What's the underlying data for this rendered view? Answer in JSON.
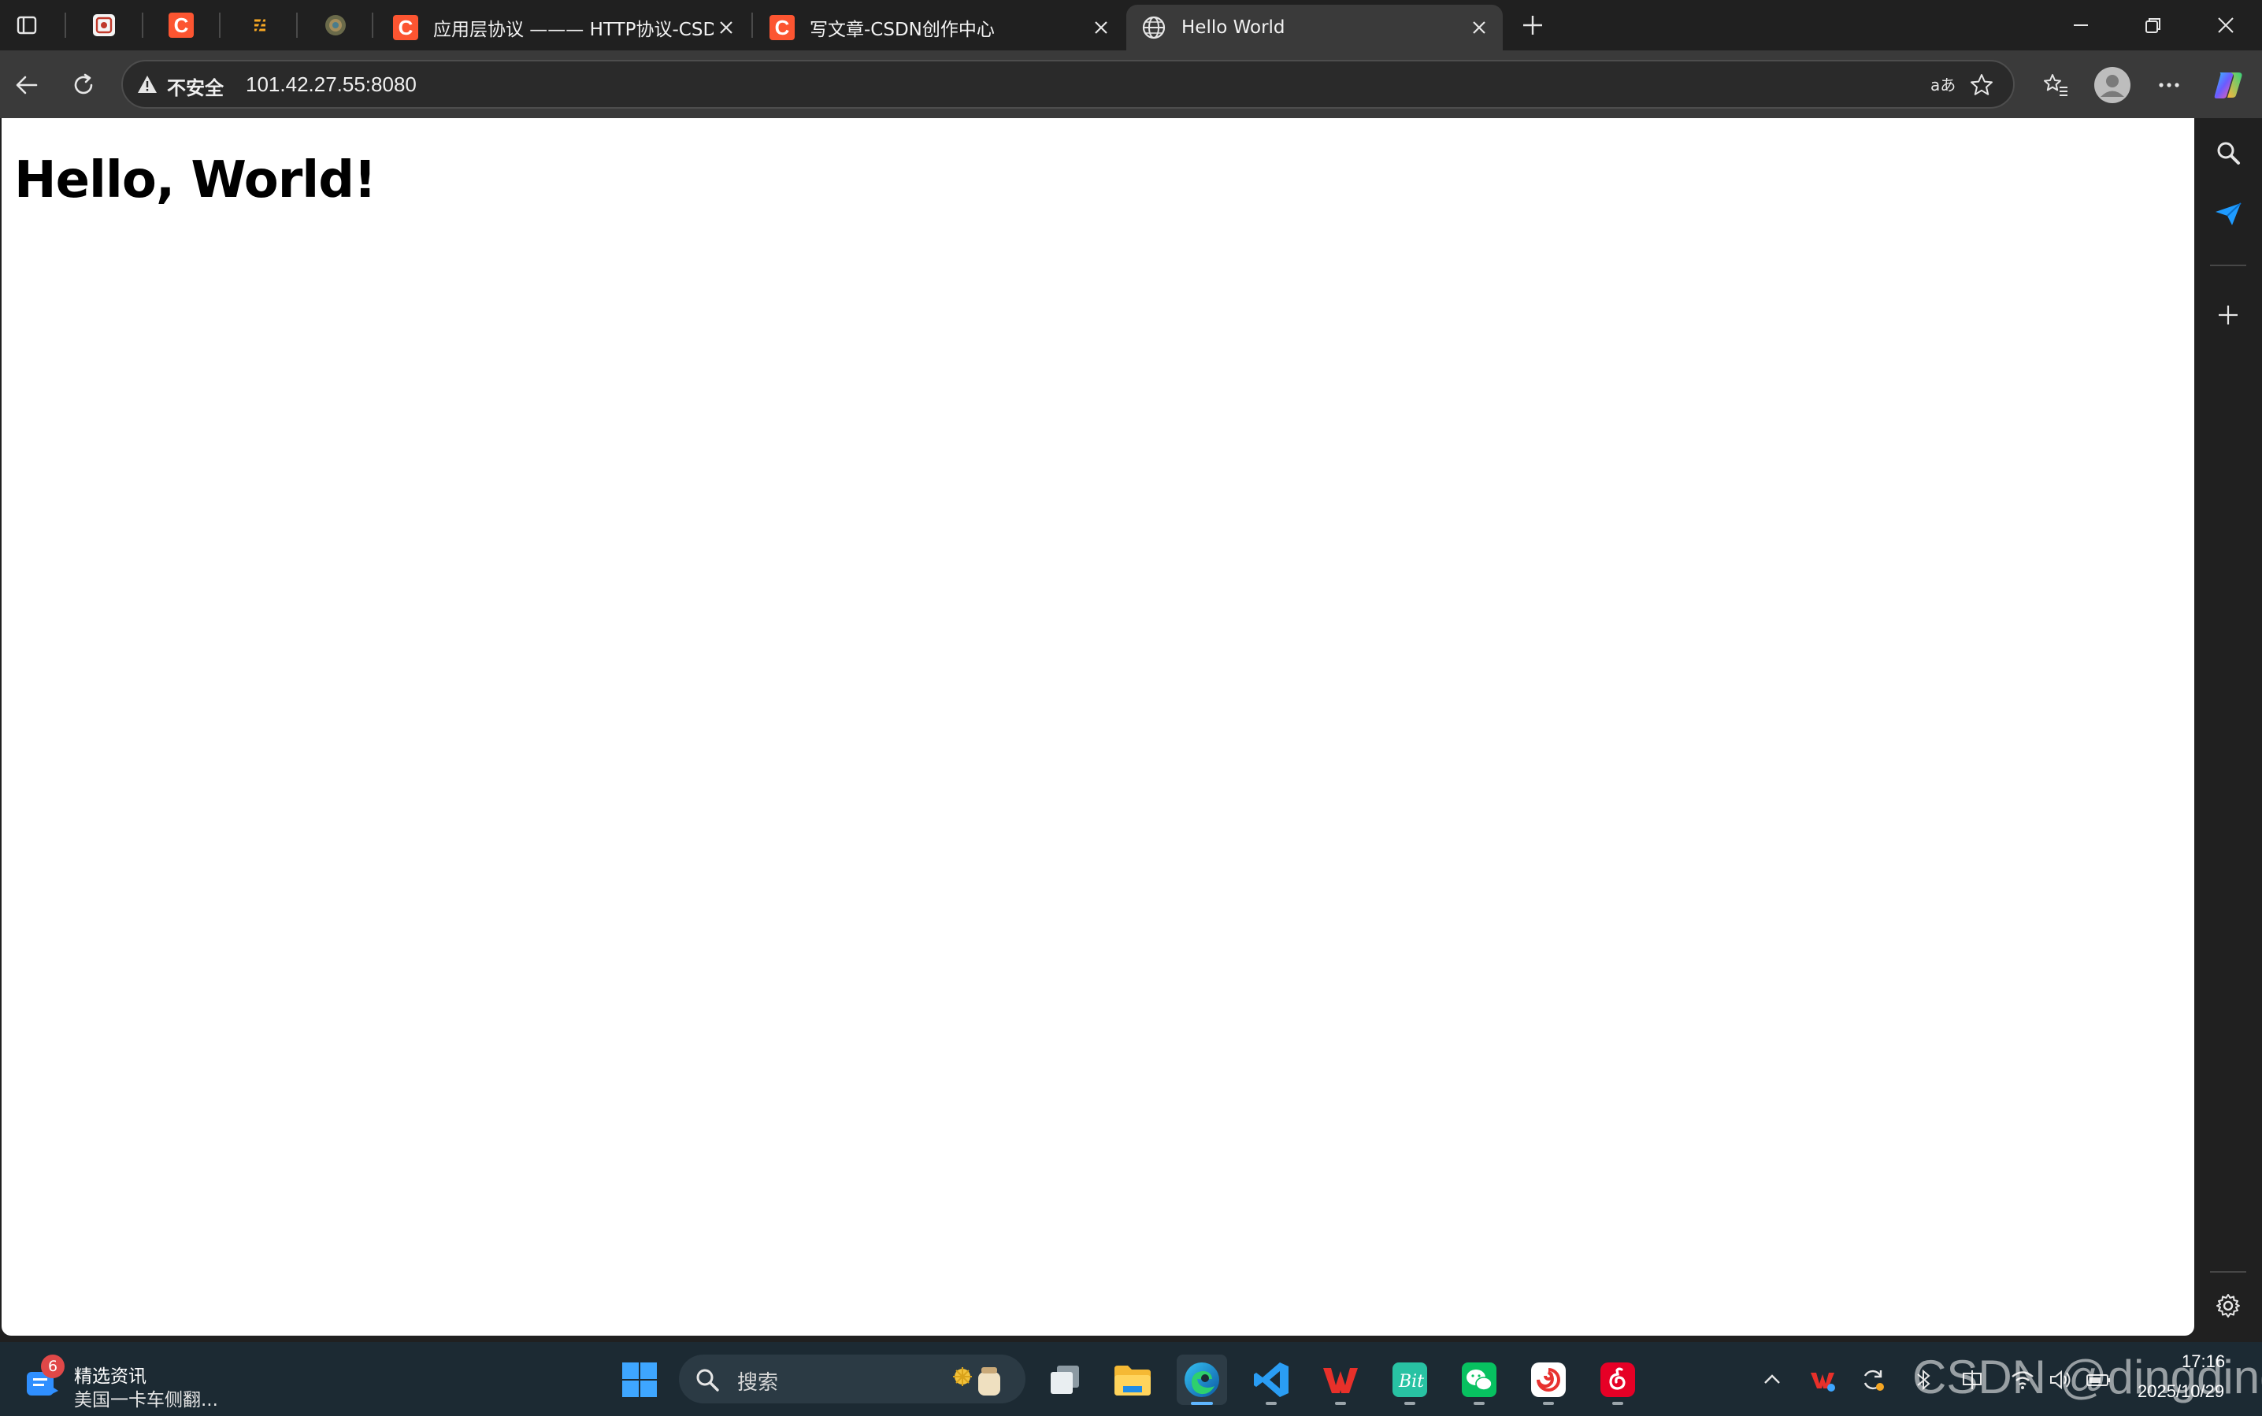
{
  "browser": {
    "tabs": [
      {
        "title": "应用层协议 ——— HTTP协议-CSDN",
        "favicon": "csdn-favicon",
        "active": false
      },
      {
        "title": "写文章-CSDN创作中心",
        "favicon": "csdn-favicon",
        "active": false
      },
      {
        "title": "Hello World",
        "favicon": "globe-icon",
        "active": true
      }
    ],
    "pinned_tabs": [
      "tab-pinned-1",
      "csdn-favicon",
      "tab-pinned-3",
      "tab-pinned-4"
    ],
    "address": {
      "security_label": "不安全",
      "url": "101.42.27.55:8080"
    }
  },
  "page": {
    "heading": "Hello, World!"
  },
  "taskbar": {
    "news": {
      "badge": "6",
      "title": "精选资讯",
      "subtitle": "美国一卡车侧翻..."
    },
    "search_placeholder": "搜索",
    "clock_time": "17:16",
    "clock_date": "2025/10/29",
    "watermark": "CSDN @dingding"
  },
  "colors": {
    "tab_strip": "#202020",
    "toolbar": "#3a3a3a",
    "page_background": "#ffffff",
    "csdn_brand": "#fc5531",
    "taskbar": "#1c2a33"
  }
}
